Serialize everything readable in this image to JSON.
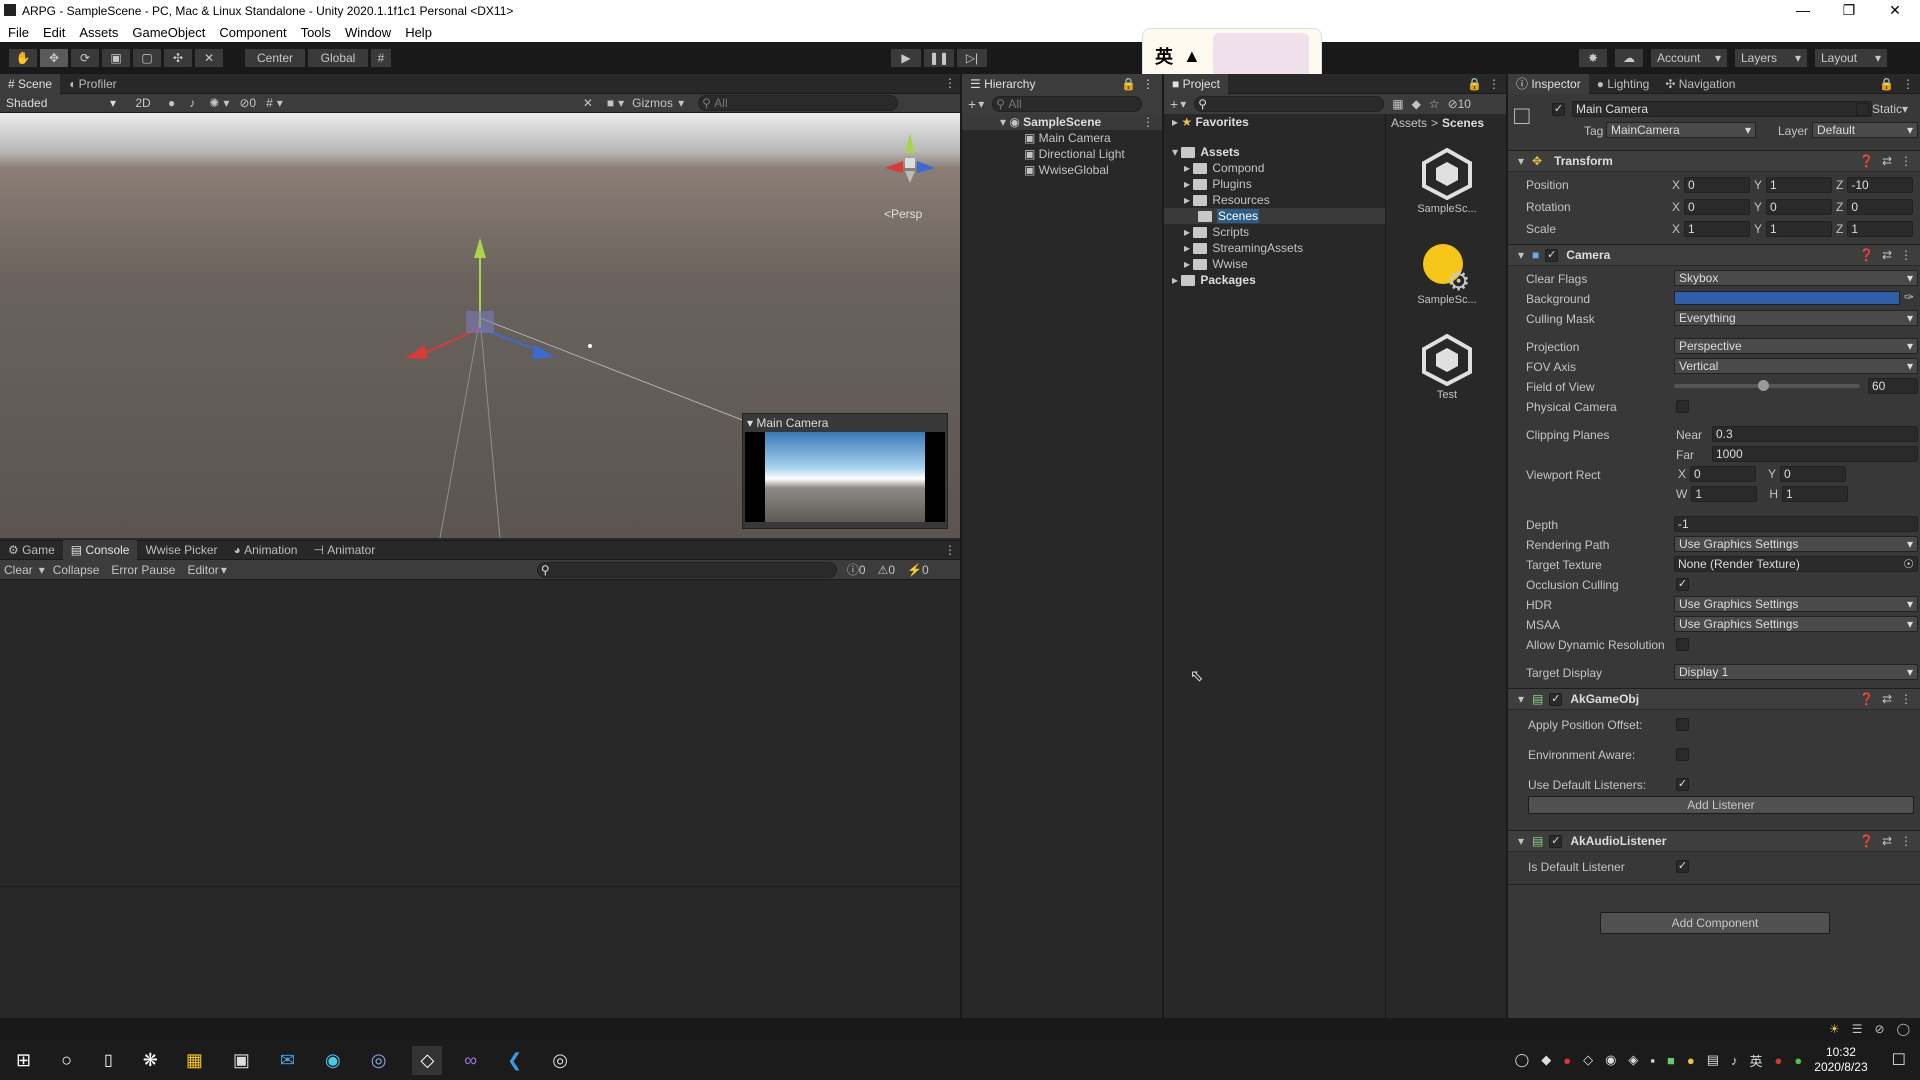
{
  "window": {
    "title": "ARPG - SampleScene - PC, Mac & Linux Standalone - Unity 2020.1.1f1c1 Personal <DX11>"
  },
  "menu": [
    "File",
    "Edit",
    "Assets",
    "GameObject",
    "Component",
    "Tools",
    "Window",
    "Help"
  ],
  "toolbar": {
    "pivot_center": "Center",
    "pivot_global": "Global",
    "account": "Account",
    "layers": "Layers",
    "layout": "Layout"
  },
  "ime": {
    "lang": "英"
  },
  "scene": {
    "tab_scene": "Scene",
    "tab_profiler": "Profiler",
    "shading": "Shaded",
    "mode_2d": "2D",
    "hidden_count": "0",
    "gizmos": "Gizmos",
    "search_placeholder": "All",
    "persp_label": "<Persp",
    "camera_preview_title": "Main Camera"
  },
  "hierarchy": {
    "tab": "Hierarchy",
    "search_placeholder": "All",
    "scene_name": "SampleScene",
    "items": [
      "Main Camera",
      "Directional Light",
      "WwiseGlobal"
    ]
  },
  "project": {
    "tab": "Project",
    "favorites": "Favorites",
    "assets": "Assets",
    "folders": [
      "Compond",
      "Plugins",
      "Resources",
      "Scenes",
      "Scripts",
      "StreamingAssets",
      "Wwise"
    ],
    "packages": "Packages",
    "breadcrumb_root": "Assets",
    "breadcrumb_sep": ">",
    "breadcrumb_current": "Scenes",
    "hidden_count": "10",
    "files": [
      "SampleSc...",
      "SampleSc...",
      "Test"
    ]
  },
  "console": {
    "tabs": [
      "Game",
      "Console",
      "Wwise Picker",
      "Animation",
      "Animator"
    ],
    "clear": "Clear",
    "collapse": "Collapse",
    "error_pause": "Error Pause",
    "editor": "Editor",
    "count_log": "0",
    "count_warn": "0",
    "count_err": "0"
  },
  "inspector": {
    "tabs": [
      "Inspector",
      "Lighting",
      "Navigation"
    ],
    "object_name": "Main Camera",
    "static": "Static",
    "tag_label": "Tag",
    "tag_value": "MainCamera",
    "layer_label": "Layer",
    "layer_value": "Default",
    "transform": {
      "title": "Transform",
      "position_label": "Position",
      "rotation_label": "Rotation",
      "scale_label": "Scale",
      "pos": [
        "0",
        "1",
        "-10"
      ],
      "rot": [
        "0",
        "0",
        "0"
      ],
      "scale": [
        "1",
        "1",
        "1"
      ]
    },
    "camera": {
      "title": "Camera",
      "clear_flags_label": "Clear Flags",
      "clear_flags": "Skybox",
      "background_label": "Background",
      "culling_mask_label": "Culling Mask",
      "culling_mask": "Everything",
      "projection_label": "Projection",
      "projection": "Perspective",
      "fov_axis_label": "FOV Axis",
      "fov_axis": "Vertical",
      "fov_label": "Field of View",
      "fov": "60",
      "fov_fraction": 0.48,
      "physical_label": "Physical Camera",
      "clipping_label": "Clipping Planes",
      "near_label": "Near",
      "near": "0.3",
      "far_label": "Far",
      "far": "1000",
      "viewport_label": "Viewport Rect",
      "vx": "0",
      "vy": "0",
      "vw": "1",
      "vh": "1",
      "depth_label": "Depth",
      "depth": "-1",
      "rendering_path_label": "Rendering Path",
      "rendering_path": "Use Graphics Settings",
      "target_texture_label": "Target Texture",
      "target_texture": "None (Render Texture)",
      "occlusion_label": "Occlusion Culling",
      "hdr_label": "HDR",
      "hdr": "Use Graphics Settings",
      "msaa_label": "MSAA",
      "msaa": "Use Graphics Settings",
      "dynres_label": "Allow Dynamic Resolution",
      "target_display_label": "Target Display",
      "target_display": "Display 1",
      "background_color": "#2f5fa8"
    },
    "akgameobj": {
      "title": "AkGameObj",
      "apply_offset": "Apply Position Offset:",
      "env_aware": "Environment Aware:",
      "default_listeners": "Use Default Listeners:",
      "add_listener": "Add Listener"
    },
    "aklistener": {
      "title": "AkAudioListener",
      "is_default": "Is Default Listener"
    },
    "add_component": "Add Component"
  },
  "taskbar": {
    "time": "10:32",
    "date": "2020/8/23",
    "ime": "英"
  }
}
